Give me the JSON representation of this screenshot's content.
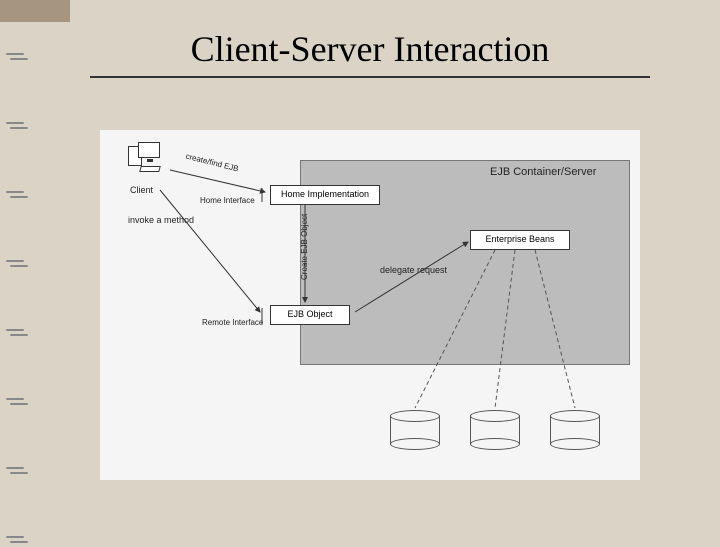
{
  "title": "Client-Server Interaction",
  "labels": {
    "container": "EJB Container/Server",
    "client": "Client",
    "home_impl": "Home Implementation",
    "home_interface": "Home Interface",
    "remote_interface": "Remote Interface",
    "ejb_object": "EJB Object",
    "enterprise_beans": "Enterprise Beans",
    "invoke": "invoke a method",
    "delegate": "delegate request",
    "create_arrow": "create/find EJB",
    "create_ejb_object": "Create EJB Object"
  }
}
